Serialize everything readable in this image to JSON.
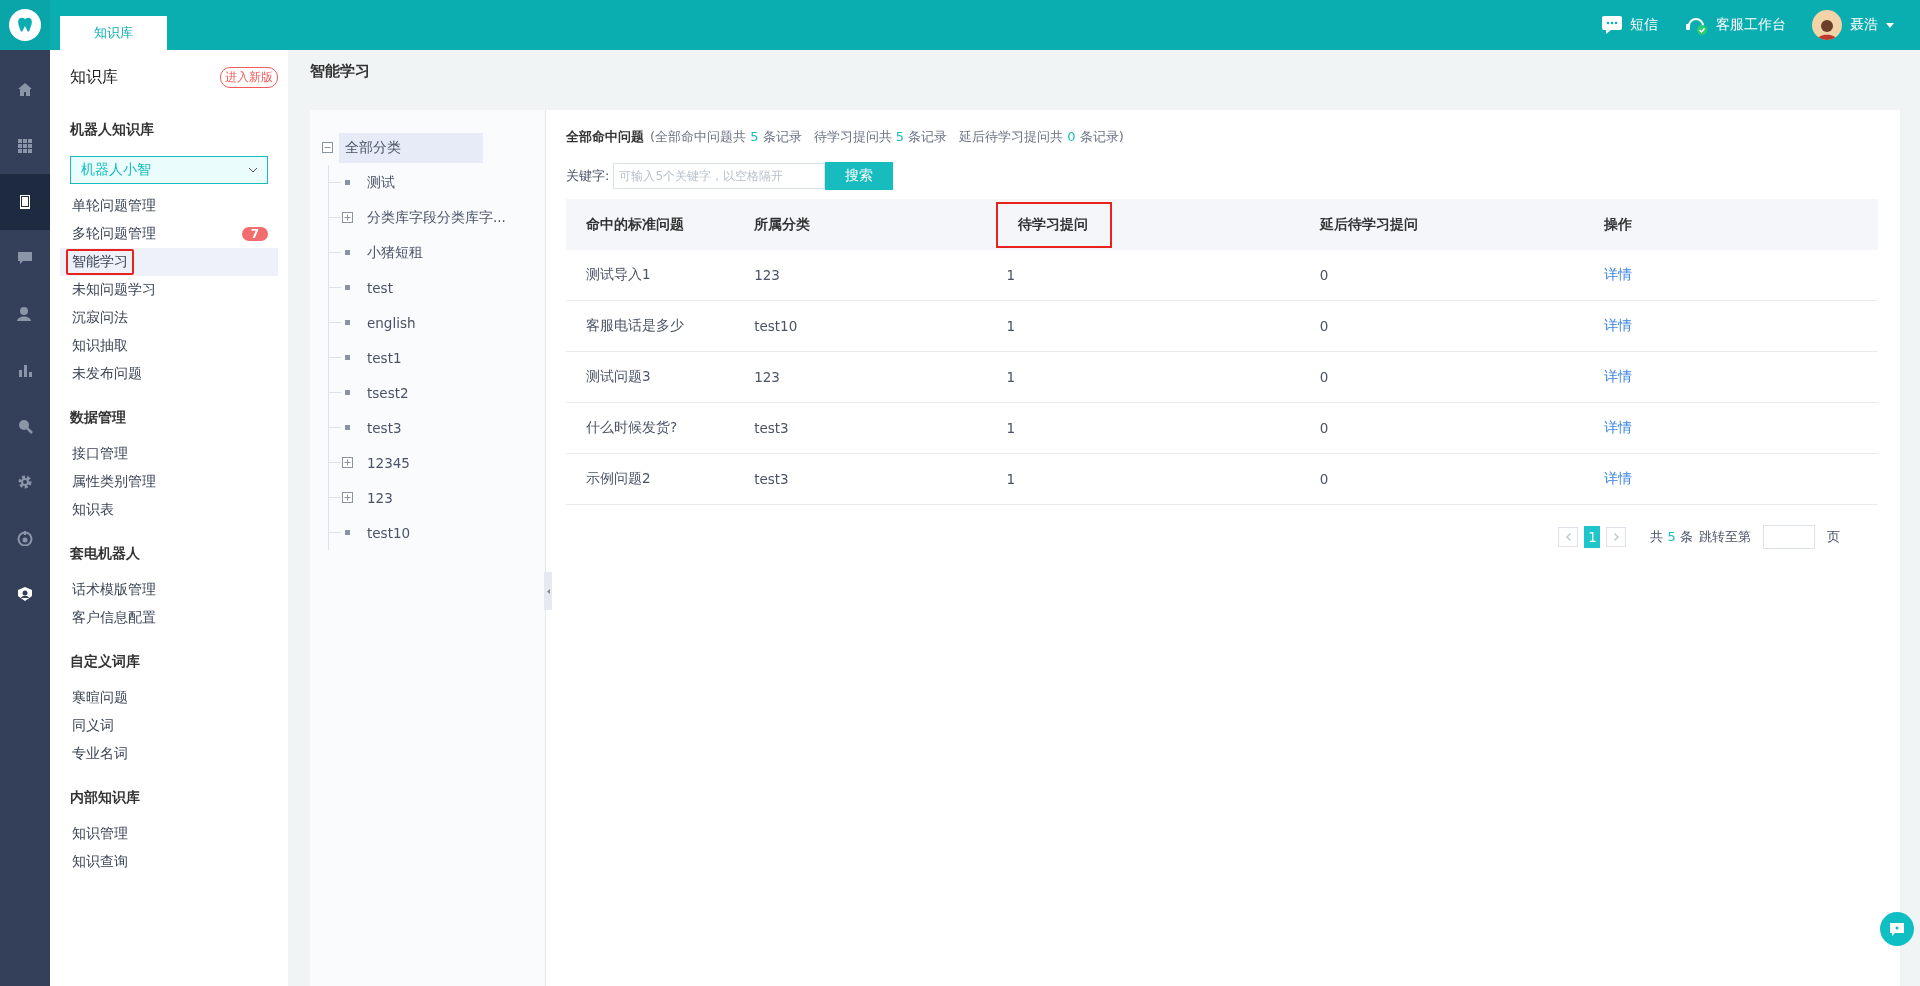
{
  "topbar": {
    "tabs": [
      {
        "label": "知识库",
        "selected": true
      }
    ],
    "sms": "短信",
    "workbench": "客服工作台",
    "user": "聂浩"
  },
  "rail": [
    {
      "kind": "home",
      "selected": false
    },
    {
      "kind": "grid",
      "selected": false
    },
    {
      "kind": "book",
      "selected": true
    },
    {
      "kind": "chat",
      "selected": false
    },
    {
      "kind": "user",
      "selected": false
    },
    {
      "kind": "chart",
      "selected": false
    },
    {
      "kind": "search",
      "selected": false
    },
    {
      "kind": "gear",
      "selected": false
    },
    {
      "kind": "target",
      "selected": false
    },
    {
      "kind": "badge",
      "selected": false
    }
  ],
  "sidebar": {
    "title": "知识库",
    "new_version": "进入新版",
    "sections": [
      {
        "title": "机器人知识库",
        "dropdown": "机器人小智",
        "items": [
          {
            "label": "单轮问题管理",
            "selected": false
          },
          {
            "label": "多轮问题管理",
            "selected": false,
            "badge": "7"
          },
          {
            "label": "智能学习",
            "selected": true,
            "highlighted": true
          },
          {
            "label": "未知问题学习",
            "selected": false
          },
          {
            "label": "沉寂问法",
            "selected": false
          },
          {
            "label": "知识抽取",
            "selected": false
          },
          {
            "label": "未发布问题",
            "selected": false
          }
        ]
      },
      {
        "title": "数据管理",
        "items": [
          {
            "label": "接口管理",
            "selected": false
          },
          {
            "label": "属性类别管理",
            "selected": false
          },
          {
            "label": "知识表",
            "selected": false
          }
        ]
      },
      {
        "title": "套电机器人",
        "items": [
          {
            "label": "话术模版管理",
            "selected": false
          },
          {
            "label": "客户信息配置",
            "selected": false
          }
        ]
      },
      {
        "title": "自定义词库",
        "items": [
          {
            "label": "寒暄问题",
            "selected": false
          },
          {
            "label": "同义词",
            "selected": false
          },
          {
            "label": "专业名词",
            "selected": false
          }
        ]
      },
      {
        "title": "内部知识库",
        "items": [
          {
            "label": "知识管理",
            "selected": false
          },
          {
            "label": "知识查询",
            "selected": false
          }
        ]
      }
    ]
  },
  "page_title": "智能学习",
  "tree": {
    "label": "全部分类",
    "expanded": true,
    "selected": true,
    "children": [
      {
        "label": "测试",
        "kind": "leaf",
        "selected": false
      },
      {
        "label": "分类库字段分类库字...",
        "kind": "folder",
        "expanded": false,
        "selected": false
      },
      {
        "label": "小猪短租",
        "kind": "leaf",
        "selected": false
      },
      {
        "label": "test",
        "kind": "leaf",
        "selected": false
      },
      {
        "label": "english",
        "kind": "leaf",
        "selected": false
      },
      {
        "label": "test1",
        "kind": "leaf",
        "selected": false
      },
      {
        "label": "tsest2",
        "kind": "leaf",
        "selected": false
      },
      {
        "label": "test3",
        "kind": "leaf",
        "selected": false
      },
      {
        "label": "12345",
        "kind": "folder",
        "expanded": false,
        "selected": false
      },
      {
        "label": "123",
        "kind": "folder",
        "expanded": false,
        "selected": false
      },
      {
        "label": "test10",
        "kind": "leaf",
        "selected": false
      }
    ]
  },
  "summary": {
    "title": "全部命中问题",
    "open": "(",
    "parts": [
      {
        "prefix": "全部命中问题共",
        "count": "5",
        "suffix": "条记录"
      },
      {
        "prefix": "待学习提问共",
        "count": "5",
        "suffix": "条记录"
      },
      {
        "prefix": "延后待学习提问共",
        "count": "0",
        "suffix": "条记录)"
      }
    ]
  },
  "search": {
    "label": "关键字:",
    "placeholder": "可输入5个关键字，以空格隔开",
    "button": "搜索"
  },
  "table": {
    "columns": [
      {
        "label": "命中的标准问题",
        "highlighted": false
      },
      {
        "label": "所属分类",
        "highlighted": false
      },
      {
        "label": "待学习提问",
        "highlighted": true
      },
      {
        "label": "延后待学习提问",
        "highlighted": false
      },
      {
        "label": "操作",
        "highlighted": false
      }
    ],
    "rows": [
      [
        "测试导入1",
        "123",
        "1",
        "0",
        "详情"
      ],
      [
        "客服电话是多少",
        "test10",
        "1",
        "0",
        "详情"
      ],
      [
        "测试问题3",
        "123",
        "1",
        "0",
        "详情"
      ],
      [
        "什么时候发货?",
        "test3",
        "1",
        "0",
        "详情"
      ],
      [
        "示例问题2",
        "test3",
        "1",
        "0",
        "详情"
      ]
    ]
  },
  "pagination": {
    "pages": [
      {
        "label": "1",
        "selected": true
      }
    ],
    "total_prefix": "共",
    "total": "5",
    "total_suffix": "条",
    "jump": "跳转至第",
    "page_unit": "页"
  }
}
